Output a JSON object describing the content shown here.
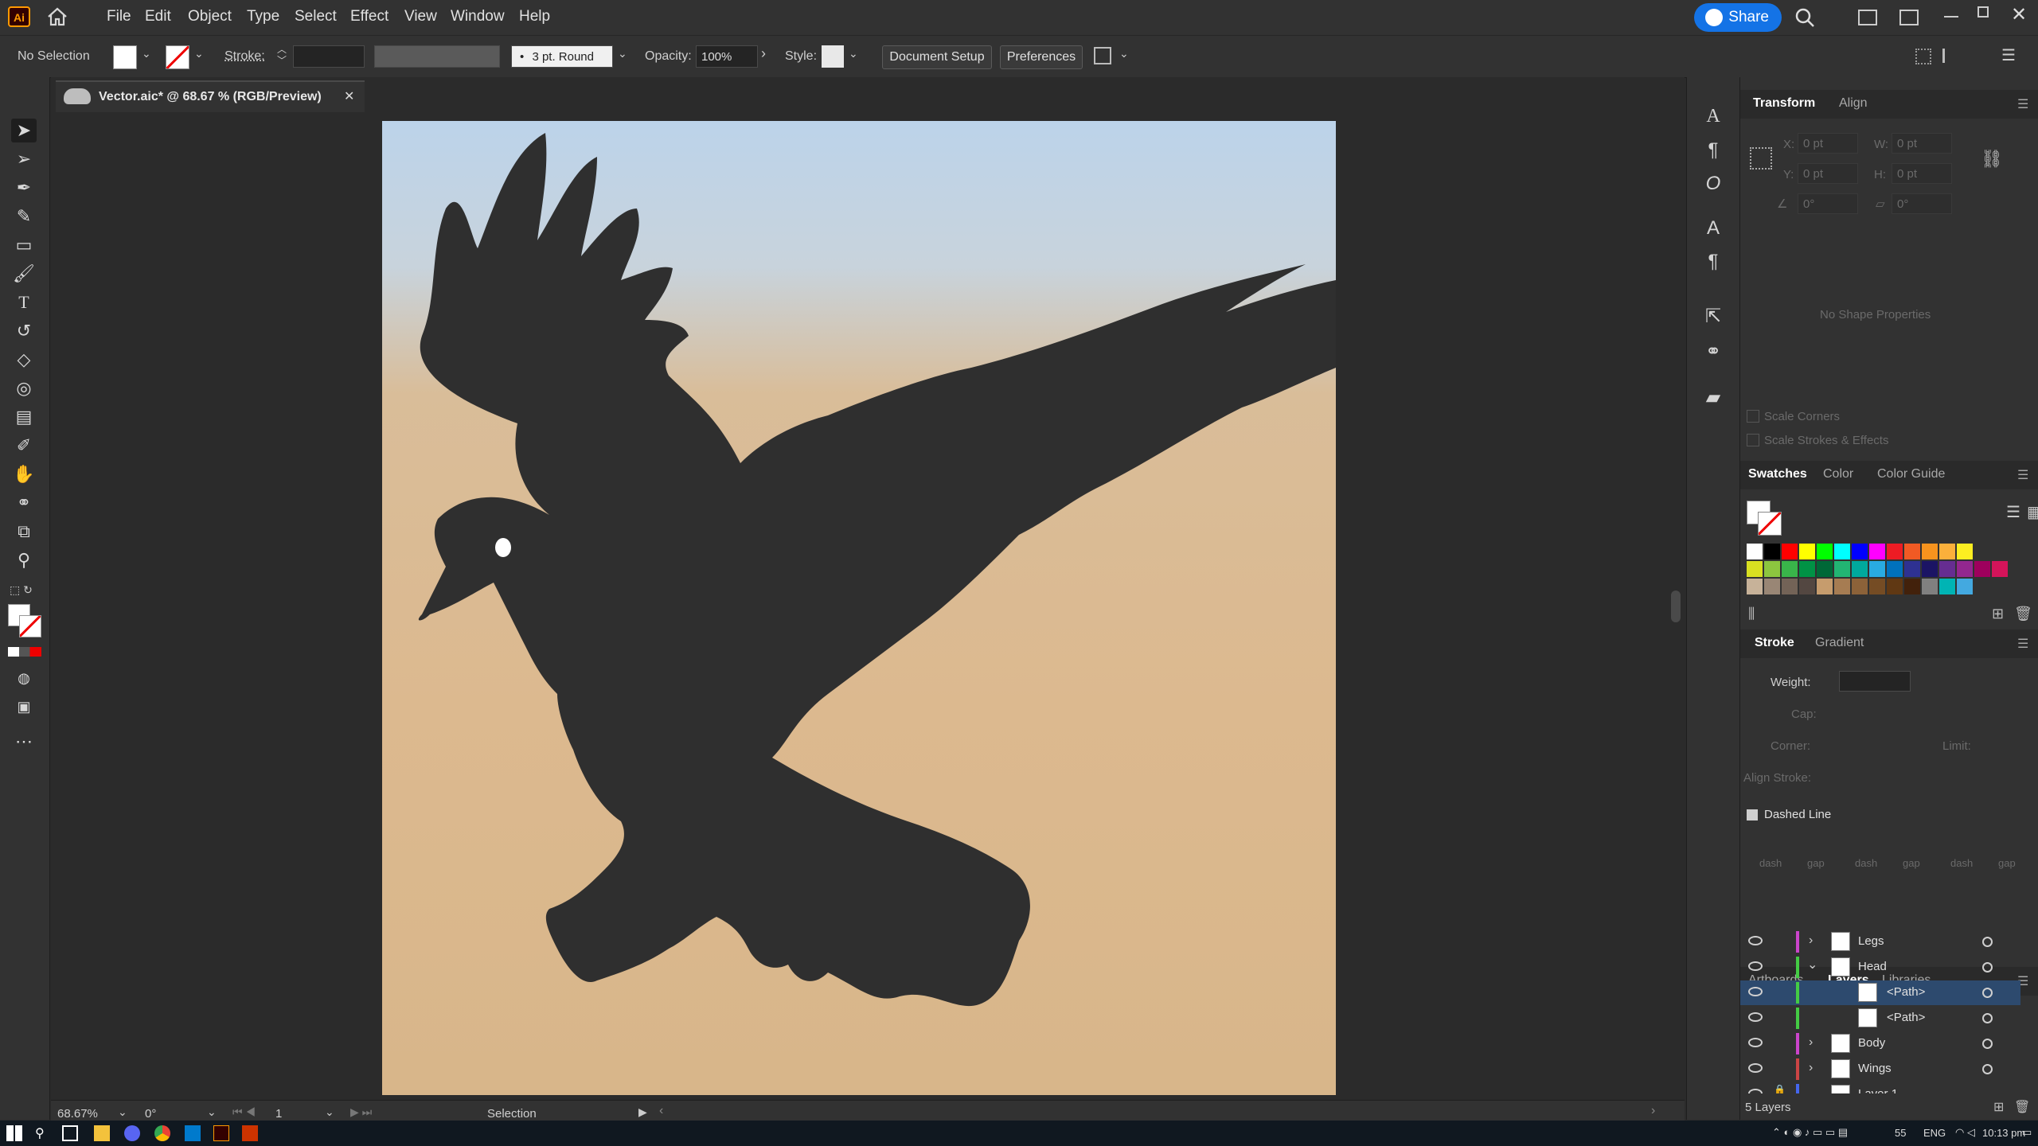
{
  "app": {
    "logo": "Ai",
    "share_label": "Share"
  },
  "menu": [
    "File",
    "Edit",
    "Object",
    "Type",
    "Select",
    "Effect",
    "View",
    "Window",
    "Help"
  ],
  "control": {
    "selection": "No Selection",
    "stroke_label": "Stroke:",
    "brush": "3 pt. Round",
    "opacity_label": "Opacity:",
    "opacity_value": "100%",
    "style_label": "Style:",
    "doc_setup": "Document Setup",
    "preferences": "Preferences"
  },
  "document": {
    "tab_title": "Vector.aic* @ 68.67 % (RGB/Preview)"
  },
  "transform": {
    "tabs": [
      "Transform",
      "Align"
    ],
    "x_label": "X:",
    "x_value": "0 pt",
    "y_label": "Y:",
    "y_value": "0 pt",
    "w_label": "W:",
    "w_value": "0 pt",
    "h_label": "H:",
    "h_value": "0 pt",
    "angle_value": "0°",
    "shear_value": "0°",
    "no_shape": "No Shape Properties",
    "scale_corners": "Scale Corners",
    "scale_strokes": "Scale Strokes & Effects"
  },
  "swatches": {
    "tabs": [
      "Swatches",
      "Color",
      "Color Guide"
    ],
    "row1": [
      "#ffffff",
      "#000000",
      "#ff0000",
      "#ffff00",
      "#00ff00",
      "#00ffff",
      "#0000ff",
      "#ff00ff",
      "#ed1c24",
      "#f15a24",
      "#f7931e",
      "#fbb03b",
      "#fcee21"
    ],
    "row2": [
      "#d9e021",
      "#8cc63f",
      "#39b54a",
      "#009245",
      "#006837",
      "#22b573",
      "#00a99d",
      "#29abe2",
      "#0071bc",
      "#2e3192",
      "#1b1464",
      "#662d91",
      "#93278f",
      "#9e005d",
      "#d4145a"
    ],
    "row3": [
      "#c7b299",
      "#998675",
      "#736357",
      "#534741",
      "#c69c6d",
      "#a67c52",
      "#8c6239",
      "#754c24",
      "#603813",
      "#42210b",
      "#808080",
      "#00b4b4",
      "#43a9e0"
    ]
  },
  "stroke": {
    "tabs": [
      "Stroke",
      "Gradient"
    ],
    "weight_label": "Weight:",
    "cap_label": "Cap:",
    "corner_label": "Corner:",
    "limit_label": "Limit:",
    "align_label": "Align Stroke:",
    "dashed_label": "Dashed Line",
    "dash_labels": [
      "dash",
      "gap",
      "dash",
      "gap",
      "dash",
      "gap"
    ]
  },
  "layers": {
    "tabs": [
      "Artboards",
      "Layers",
      "Libraries"
    ],
    "rows": [
      {
        "name": "Legs",
        "color": "#cc44cc"
      },
      {
        "name": "Head",
        "color": "#44cc44"
      },
      {
        "name": "<Path>",
        "color": "#44cc44"
      },
      {
        "name": "<Path>",
        "color": "#44cc44"
      },
      {
        "name": "Body",
        "color": "#cc44cc"
      },
      {
        "name": "Wings",
        "color": "#cc4444"
      },
      {
        "name": "Layer 1",
        "color": "#4466ee"
      }
    ],
    "count": "5 Layers"
  },
  "status": {
    "zoom": "68.67%",
    "rotate": "0°",
    "artboard": "1",
    "tool": "Selection"
  },
  "taskbar": {
    "lang": "ENG",
    "time": "10:13 pm",
    "num": "55"
  }
}
